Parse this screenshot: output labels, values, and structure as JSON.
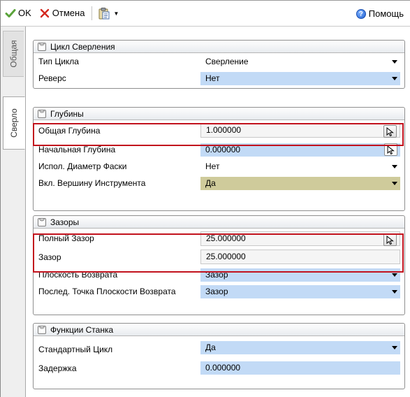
{
  "toolbar": {
    "ok_label": "OK",
    "cancel_label": "Отмена",
    "help_label": "Помощь",
    "ok_icon": "checkmark-icon",
    "cancel_icon": "x-icon",
    "clipboard_icon": "clipboard-icon",
    "help_icon": "help-circle-icon"
  },
  "tabs": [
    {
      "label": "Общая"
    },
    {
      "label": "Сверло"
    }
  ],
  "sections": {
    "cycle": {
      "title": "Цикл Сверления",
      "rows": [
        {
          "label": "Тип Цикла",
          "value": "Сверление"
        },
        {
          "label": "Реверс",
          "value": "Нет"
        }
      ]
    },
    "depths": {
      "title": "Глубины",
      "rows": [
        {
          "label": "Общая Глубина",
          "value": "1.000000"
        },
        {
          "label": "Начальная Глубина",
          "value": "0.000000"
        },
        {
          "label": "Испол. Диаметр Фаски",
          "value": "Нет"
        },
        {
          "label": "Вкл. Вершину Инструмента",
          "value": "Да"
        }
      ]
    },
    "clearances": {
      "title": "Зазоры",
      "rows": [
        {
          "label": "Полный Зазор",
          "value": "25.000000"
        },
        {
          "label": "Зазор",
          "value": "25.000000"
        },
        {
          "label": "Плоскость Возврата",
          "value": "Зазор"
        },
        {
          "label": "Послед. Точка Плоскости Возврата",
          "value": "Зазор"
        }
      ]
    },
    "machine": {
      "title": "Функции Станка",
      "rows": [
        {
          "label": "Стандартный Цикл",
          "value": "Да"
        },
        {
          "label": "Задержка",
          "value": "0.000000"
        }
      ]
    }
  },
  "colors": {
    "blue_field": "#c2daf6",
    "olive_field": "#cfcb9b",
    "highlight": "#c2121d"
  }
}
